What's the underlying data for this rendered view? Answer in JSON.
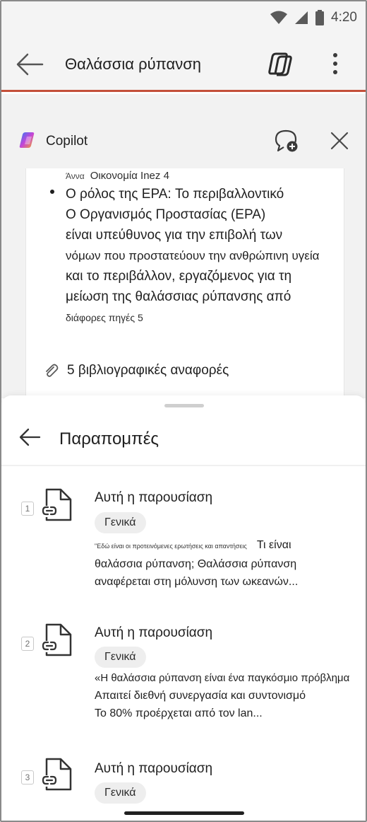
{
  "status_bar": {
    "time": "4:20"
  },
  "app_bar": {
    "title": "Θαλάσσια ρύπανση"
  },
  "copilot": {
    "title": "Copilot",
    "source_prefix": "Άννα",
    "source_line": "Οικονομία Inez 4",
    "bullet_lines": [
      "Ο ρόλος της EPA: Το περιβαλλοντικό",
      "Ο Οργανισμός Προστασίας (EPA)",
      "είναι υπεύθυνος για την επιβολή των",
      "νόμων που προστατεύουν την ανθρώπινη υγεία",
      "και το περιβάλλον, εργαζόμενος για τη",
      "μείωση της θαλάσσιας ρύπανσης από"
    ],
    "bullet_tail": "διάφορες πηγές 5",
    "references_label": "5 βιβλιογραφικές αναφορές"
  },
  "sheet": {
    "title": "Παραπομπές",
    "references": [
      {
        "number": "1",
        "title": "Αυτή η παρουσίαση",
        "tag": "Γενικά",
        "small_prefix": "\"Εδώ είναι οι προτεινόμενες ερωτήσεις και απαντήσεις",
        "lines": [
          "Τι είναι",
          "θαλάσσια ρύπανση;   Θαλάσσια ρύπανση",
          "αναφέρεται στη μόλυνση των ωκεανών..."
        ]
      },
      {
        "number": "2",
        "title": "Αυτή η παρουσίαση",
        "tag": "Γενικά",
        "lines": [
          "«Η θαλάσσια ρύπανση είναι ένα παγκόσμιο πρόβλημα",
          "Απαιτεί διεθνή συνεργασία και συντονισμό",
          "Το 80% προέρχεται από τον lan..."
        ]
      },
      {
        "number": "3",
        "title": "Αυτή η παρουσίαση",
        "tag": "Γενικά"
      }
    ]
  },
  "colors": {
    "accent_line": "#c4503a",
    "panel_bg": "#f2f2f2",
    "tag_bg": "#eeeeee"
  }
}
